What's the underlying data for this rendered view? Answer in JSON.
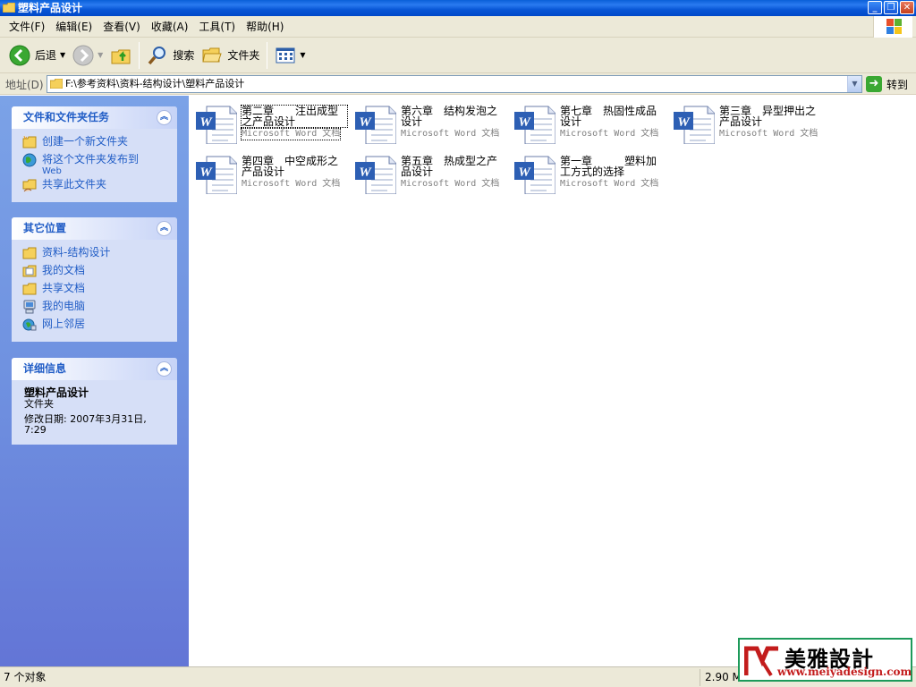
{
  "window": {
    "title": "塑料产品设计"
  },
  "menu": [
    "文件(F)",
    "编辑(E)",
    "查看(V)",
    "收藏(A)",
    "工具(T)",
    "帮助(H)"
  ],
  "toolbar": {
    "back": "后退",
    "search": "搜索",
    "folders": "文件夹"
  },
  "address": {
    "label": "地址(D)",
    "path": "F:\\参考资料\\资料-结构设计\\塑料产品设计",
    "go": "转到"
  },
  "tasks": {
    "title": "文件和文件夹任务",
    "items": [
      {
        "label": "创建一个新文件夹",
        "icon": "new-folder-icon"
      },
      {
        "label": "将这个文件夹发布到",
        "sub": "Web",
        "icon": "publish-web-icon"
      },
      {
        "label": "共享此文件夹",
        "icon": "share-folder-icon"
      }
    ]
  },
  "places": {
    "title": "其它位置",
    "items": [
      {
        "label": "资料-结构设计",
        "icon": "folder-icon"
      },
      {
        "label": "我的文档",
        "icon": "my-documents-icon"
      },
      {
        "label": "共享文档",
        "icon": "shared-documents-icon"
      },
      {
        "label": "我的电脑",
        "icon": "my-computer-icon"
      },
      {
        "label": "网上邻居",
        "icon": "network-places-icon"
      }
    ]
  },
  "details": {
    "title": "详细信息",
    "name": "塑料产品设计",
    "type": "文件夹",
    "modified": "修改日期: 2007年3月31日,",
    "time": "7:29"
  },
  "files": [
    {
      "name": "第二章　　注出成型之产品设计",
      "type": "Microsoft Word 文档"
    },
    {
      "name": "第六章　结构发泡之设计",
      "type": "Microsoft Word 文档"
    },
    {
      "name": "第七章　热固性成品设计",
      "type": "Microsoft Word 文档"
    },
    {
      "name": "第三章　异型押出之产品设计",
      "type": "Microsoft Word 文档"
    },
    {
      "name": "第四章　中空成形之产品设计",
      "type": "Microsoft Word 文档"
    },
    {
      "name": "第五章　热成型之产品设计",
      "type": "Microsoft Word 文档"
    },
    {
      "name": "第一章　　　塑料加工方式的选择",
      "type": "Microsoft Word 文档"
    }
  ],
  "status": {
    "count": "7 个对象",
    "size": "2.90 M"
  },
  "watermark": {
    "brand": "美雅設計",
    "url": "www.meiyadesign.com"
  },
  "colors": {
    "titlebar": "#0a5fd8",
    "link": "#215dc6",
    "pane": "#6f91e0",
    "panel": "#d6dff7"
  }
}
